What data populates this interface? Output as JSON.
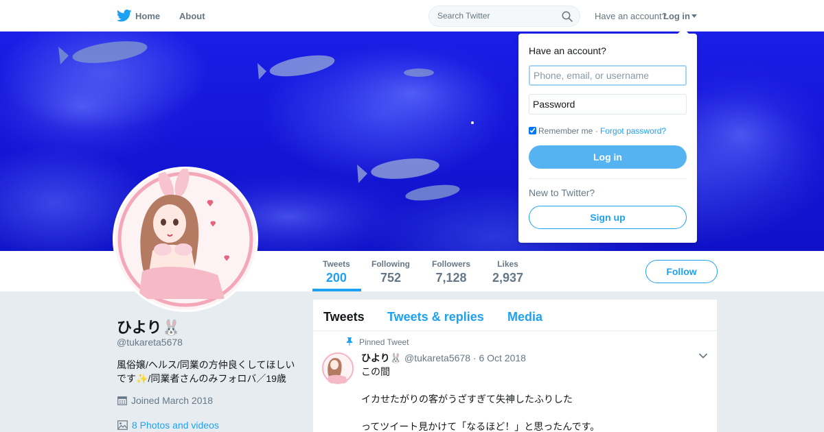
{
  "nav": {
    "home_label": "Home",
    "about_label": "About",
    "search_placeholder": "Search Twitter",
    "have_account": "Have an account?",
    "login_label": "Log in",
    "logo_icon": "twitter-bird-icon",
    "brand_color": "#1da1f2"
  },
  "banner": {
    "image": "blue-aquarium-fish-photo"
  },
  "stats": [
    {
      "label": "Tweets",
      "value": "200"
    },
    {
      "label": "Following",
      "value": "752"
    },
    {
      "label": "Followers",
      "value": "7,128"
    },
    {
      "label": "Likes",
      "value": "2,937"
    }
  ],
  "follow_label": "Follow",
  "profile": {
    "name": "ひより🐰",
    "handle": "@tukareta5678",
    "bio": "風俗嬢/ヘルス/同業の方仲良くしてほしいです✨/同業者さんのみフォロバ／19歳",
    "joined": "Joined March 2018",
    "photos": "8 Photos and videos"
  },
  "timeline": {
    "tabs": [
      "Tweets",
      "Tweets & replies",
      "Media"
    ],
    "tweet": {
      "pinned_label": "Pinned Tweet",
      "name": "ひより🐰",
      "handle": "@tukareta5678",
      "date": "· 6 Oct 2018",
      "lines": [
        "この間",
        "イカせたがりの客がうざすぎて失神したふりした",
        "ってツイート見かけて「なるほど！」と思ったんです。"
      ]
    }
  },
  "login_dropdown": {
    "title": "Have an account?",
    "username_placeholder": "Phone, email, or username",
    "password_placeholder": "Password",
    "remember": "Remember me",
    "separator": "·",
    "forgot": "Forgot password?",
    "login_button": "Log in",
    "new_to": "New to Twitter?",
    "signup_button": "Sign up"
  }
}
